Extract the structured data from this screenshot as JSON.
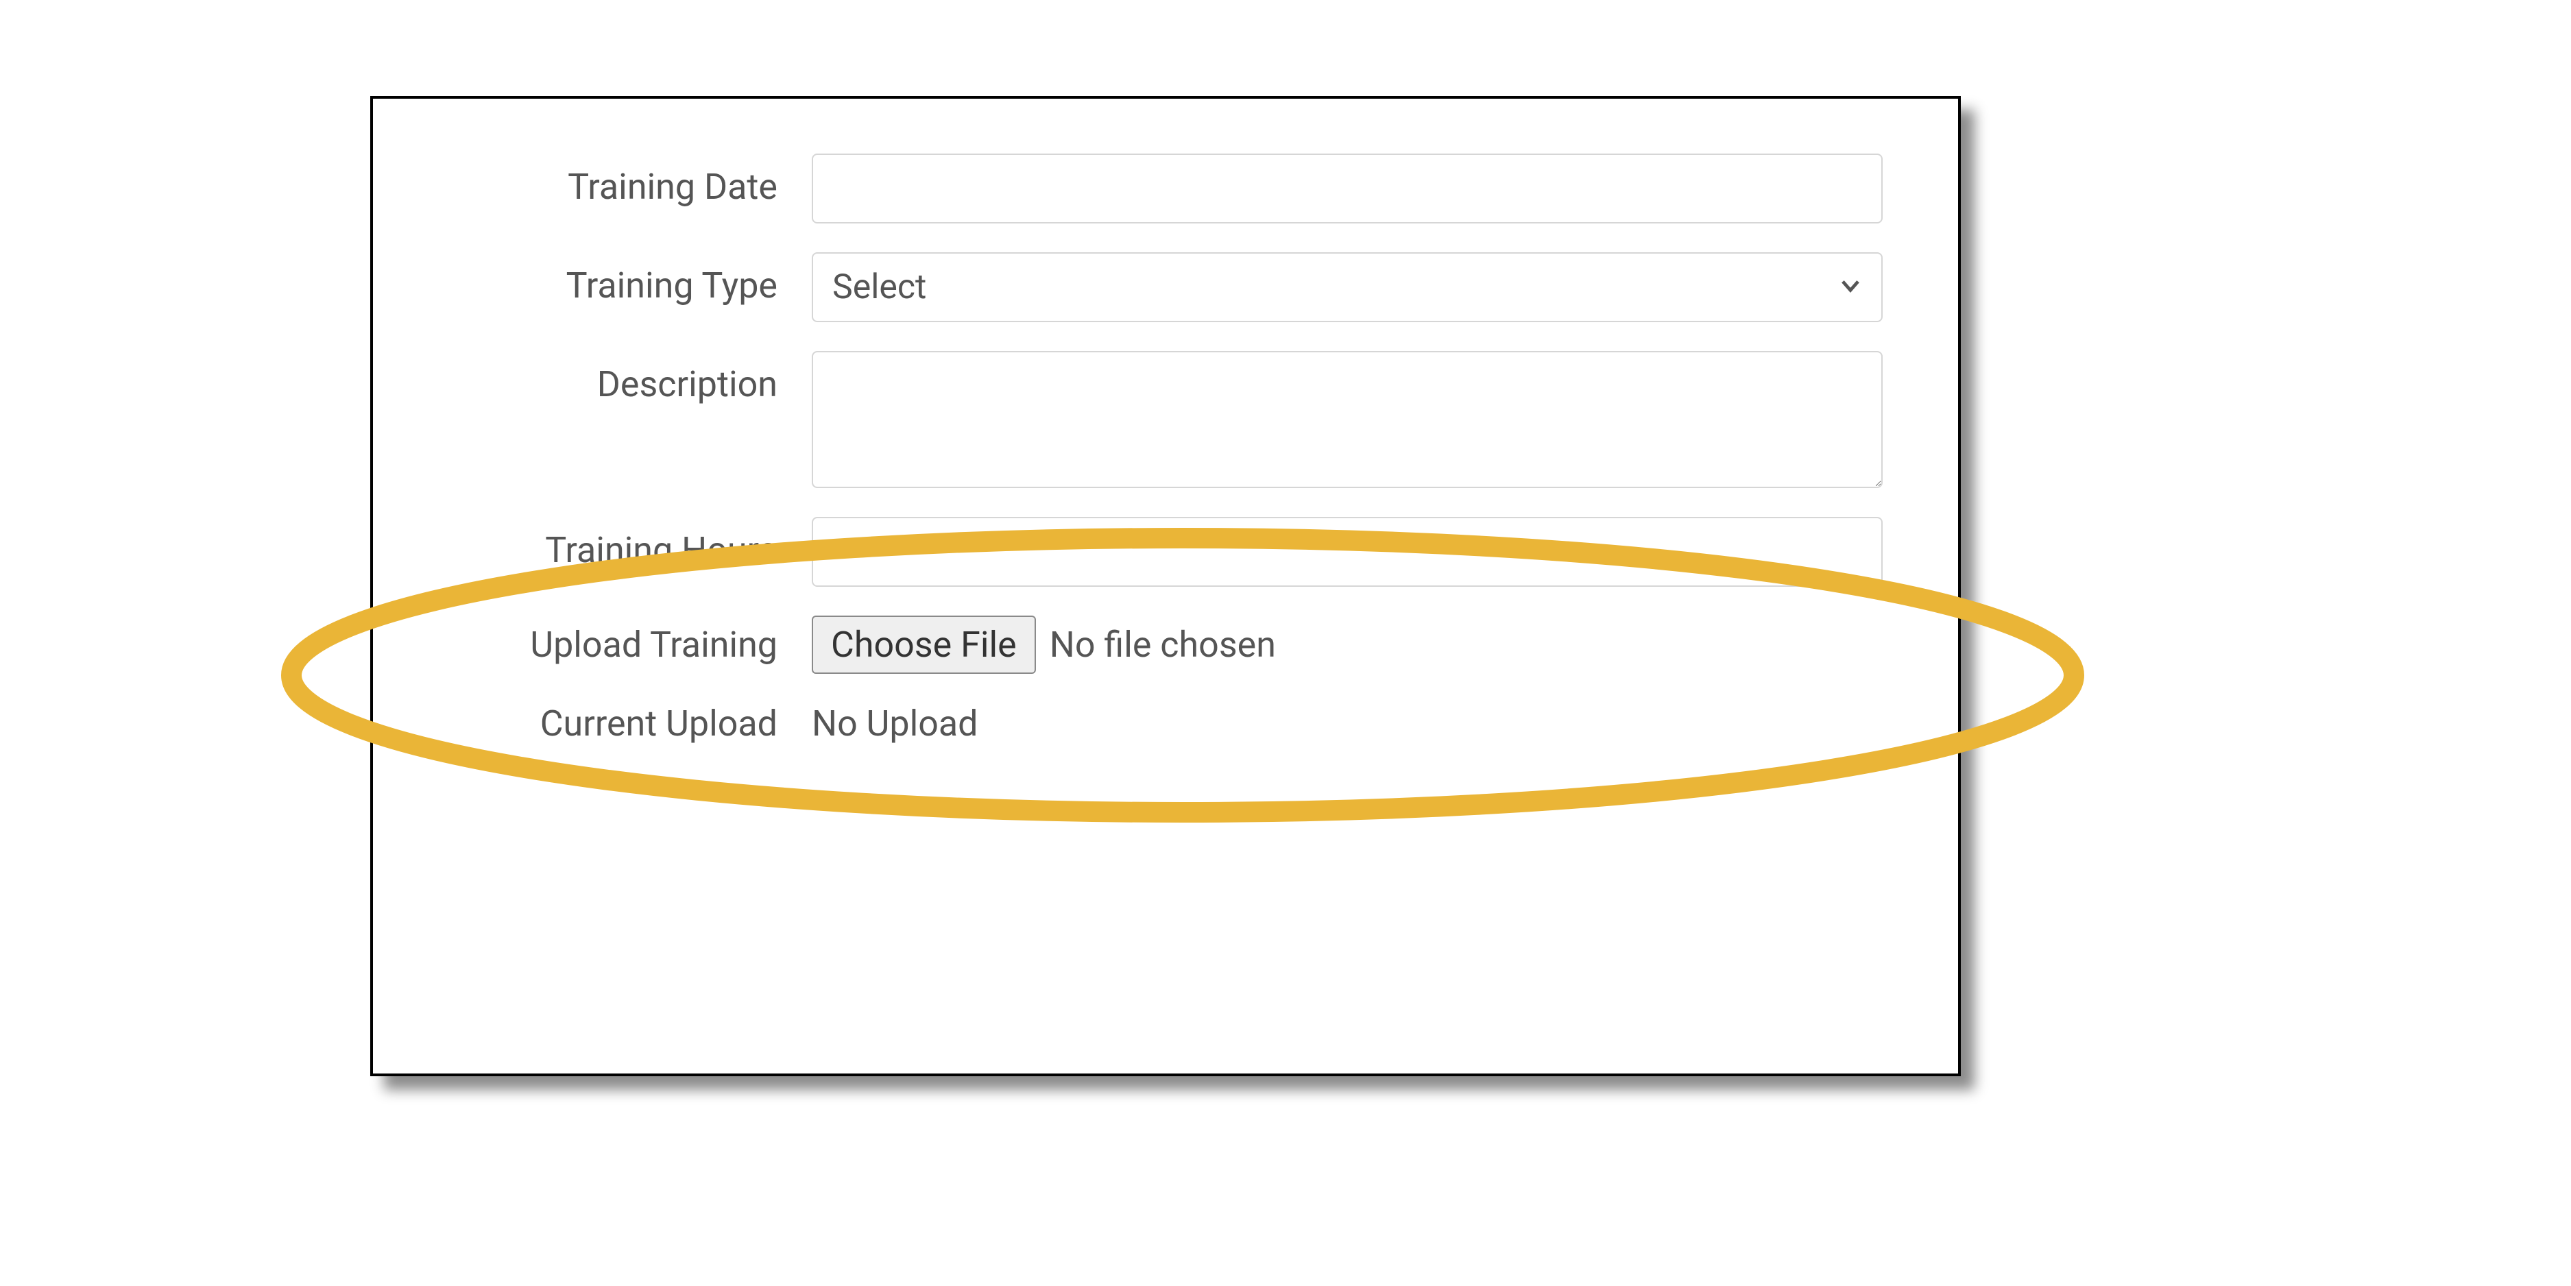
{
  "form": {
    "training_date": {
      "label": "Training Date",
      "value": ""
    },
    "training_type": {
      "label": "Training Type",
      "selected": "Select"
    },
    "description": {
      "label": "Description",
      "value": ""
    },
    "training_hours": {
      "label": "Training Hours",
      "value": ""
    },
    "upload_training": {
      "label": "Upload Training",
      "button_label": "Choose File",
      "status": "No file chosen"
    },
    "current_upload": {
      "label": "Current Upload",
      "value": "No Upload"
    }
  },
  "annotation": {
    "ellipse_color": "#eab537"
  }
}
